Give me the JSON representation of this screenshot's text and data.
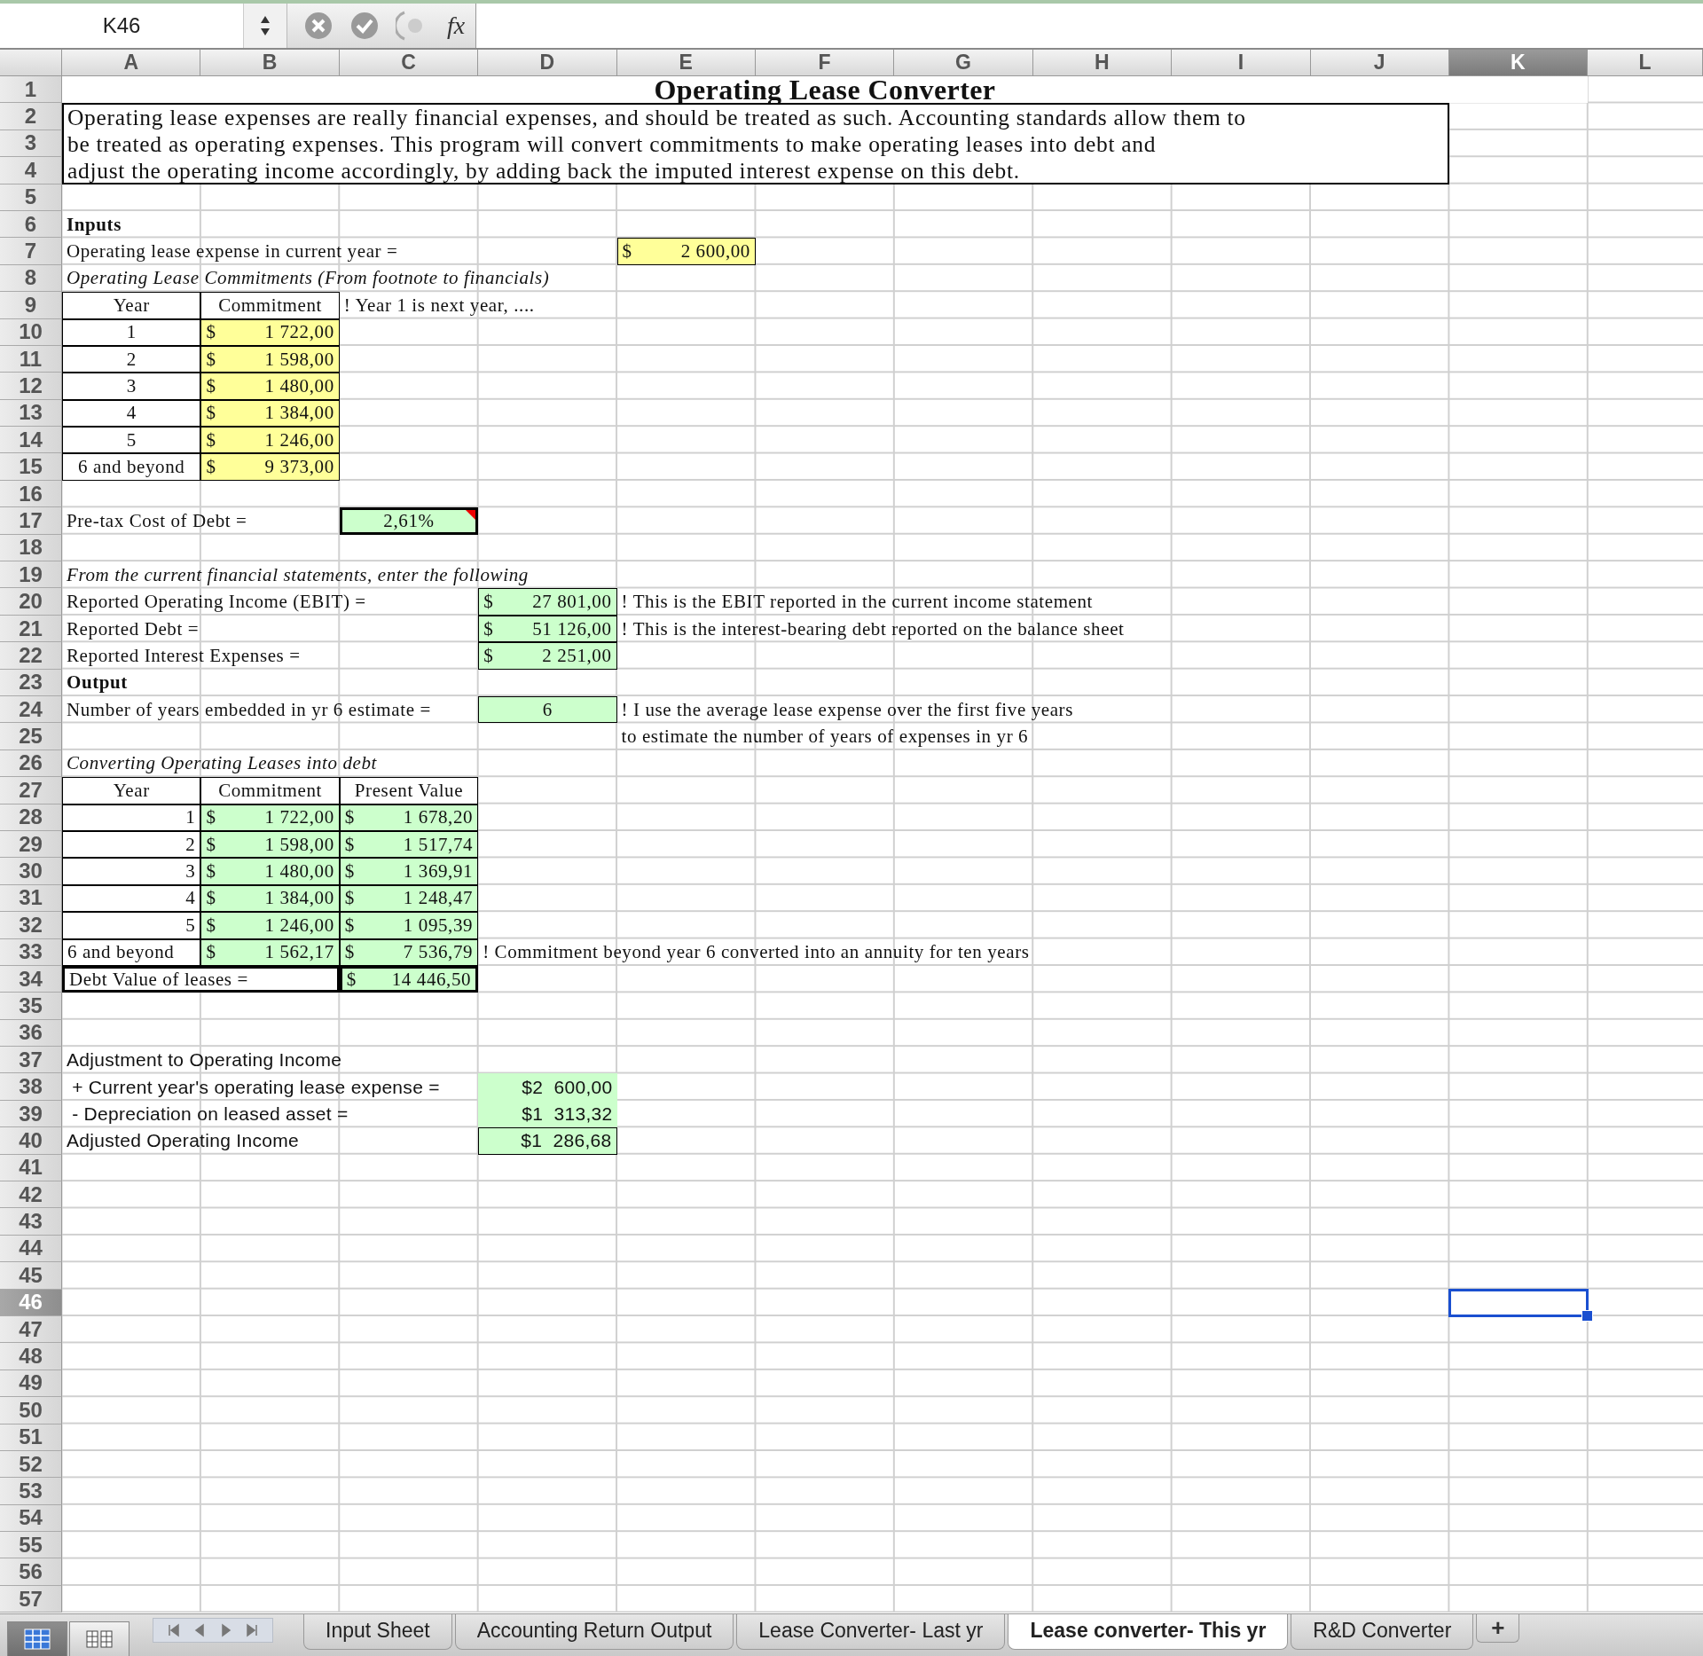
{
  "formula_bar": {
    "name_box": "K46",
    "function_label": "fx"
  },
  "columns": [
    {
      "label": "A",
      "selected": false
    },
    {
      "label": "B",
      "selected": false
    },
    {
      "label": "C",
      "selected": false
    },
    {
      "label": "D",
      "selected": false
    },
    {
      "label": "E",
      "selected": false
    },
    {
      "label": "F",
      "selected": false
    },
    {
      "label": "G",
      "selected": false
    },
    {
      "label": "H",
      "selected": false
    },
    {
      "label": "I",
      "selected": false
    },
    {
      "label": "J",
      "selected": false
    },
    {
      "label": "K",
      "selected": true
    },
    {
      "label": "L",
      "selected": false
    }
  ],
  "rows": [
    {
      "label": "1",
      "selected": false
    },
    {
      "label": "2",
      "selected": false
    },
    {
      "label": "3",
      "selected": false
    },
    {
      "label": "4",
      "selected": false
    },
    {
      "label": "5",
      "selected": false
    },
    {
      "label": "6",
      "selected": false
    },
    {
      "label": "7",
      "selected": false
    },
    {
      "label": "8",
      "selected": false
    },
    {
      "label": "9",
      "selected": false
    },
    {
      "label": "10",
      "selected": false
    },
    {
      "label": "11",
      "selected": false
    },
    {
      "label": "12",
      "selected": false
    },
    {
      "label": "13",
      "selected": false
    },
    {
      "label": "14",
      "selected": false
    },
    {
      "label": "15",
      "selected": false
    },
    {
      "label": "16",
      "selected": false
    },
    {
      "label": "17",
      "selected": false
    },
    {
      "label": "18",
      "selected": false
    },
    {
      "label": "19",
      "selected": false
    },
    {
      "label": "20",
      "selected": false
    },
    {
      "label": "21",
      "selected": false
    },
    {
      "label": "22",
      "selected": false
    },
    {
      "label": "23",
      "selected": false
    },
    {
      "label": "24",
      "selected": false
    },
    {
      "label": "25",
      "selected": false
    },
    {
      "label": "26",
      "selected": false
    },
    {
      "label": "27",
      "selected": false
    },
    {
      "label": "28",
      "selected": false
    },
    {
      "label": "29",
      "selected": false
    },
    {
      "label": "30",
      "selected": false
    },
    {
      "label": "31",
      "selected": false
    },
    {
      "label": "32",
      "selected": false
    },
    {
      "label": "33",
      "selected": false
    },
    {
      "label": "34",
      "selected": false
    },
    {
      "label": "35",
      "selected": false
    },
    {
      "label": "36",
      "selected": false
    },
    {
      "label": "37",
      "selected": false
    },
    {
      "label": "38",
      "selected": false
    },
    {
      "label": "39",
      "selected": false
    },
    {
      "label": "40",
      "selected": false
    },
    {
      "label": "41",
      "selected": false
    },
    {
      "label": "42",
      "selected": false
    },
    {
      "label": "43",
      "selected": false
    },
    {
      "label": "44",
      "selected": false
    },
    {
      "label": "45",
      "selected": false
    },
    {
      "label": "46",
      "selected": true
    },
    {
      "label": "47",
      "selected": false
    },
    {
      "label": "48",
      "selected": false
    },
    {
      "label": "49",
      "selected": false
    },
    {
      "label": "50",
      "selected": false
    },
    {
      "label": "51",
      "selected": false
    },
    {
      "label": "52",
      "selected": false
    },
    {
      "label": "53",
      "selected": false
    },
    {
      "label": "54",
      "selected": false
    },
    {
      "label": "55",
      "selected": false
    },
    {
      "label": "56",
      "selected": false
    },
    {
      "label": "57",
      "selected": false
    }
  ],
  "sheet": {
    "title": "Operating Lease Converter",
    "description": [
      "Operating lease expenses are really financial expenses, and should be treated as such. Accounting standards allow them to",
      "be treated as operating expenses. This program will convert commitments to make operating leases into debt and",
      "adjust the operating income accordingly, by adding back the imputed interest expense on this debt."
    ],
    "inputs_heading": "Inputs",
    "lease_expense": {
      "label": "Operating lease expense in current year =",
      "unit": "$",
      "amount": "2 600,00"
    },
    "commitments_heading": "Operating Lease Commitments (From footnote to financials)",
    "commitment_table": {
      "columns": [
        "Year",
        "Commitment"
      ],
      "note": "! Year 1 is next year, ....",
      "rows": [
        {
          "year": "1",
          "unit": "$",
          "amount": "1 722,00"
        },
        {
          "year": "2",
          "unit": "$",
          "amount": "1 598,00"
        },
        {
          "year": "3",
          "unit": "$",
          "amount": "1 480,00"
        },
        {
          "year": "4",
          "unit": "$",
          "amount": "1 384,00"
        },
        {
          "year": "5",
          "unit": "$",
          "amount": "1 246,00"
        },
        {
          "year": "6 and beyond",
          "unit": "$",
          "amount": "9 373,00"
        }
      ]
    },
    "cost_of_debt": {
      "label": "Pre-tax Cost of Debt =",
      "value": "2,61%",
      "comment": true
    },
    "statements_heading": "From the current financial statements, enter the following",
    "statement_items": [
      {
        "label": "Reported Operating Income (EBIT) =",
        "unit": "$",
        "amount": "27 801,00",
        "note": "! This is the EBIT reported in the current income statement"
      },
      {
        "label": "Reported Debt =",
        "unit": "$",
        "amount": "51 126,00",
        "note": "! This is the interest-bearing debt reported on the balance sheet"
      },
      {
        "label": "Reported Interest Expenses =",
        "unit": "$",
        "amount": "2 251,00"
      }
    ],
    "output_heading": "Output",
    "years_embedded": {
      "label": "Number of years embedded in yr 6 estimate =",
      "value": "6",
      "note_lines": [
        "! I use the average lease expense over the first five years",
        "to estimate the number of years of expenses in yr 6"
      ]
    },
    "conversion_heading": "Converting Operating Leases into debt",
    "conversion_table": {
      "columns": [
        "Year",
        "Commitment",
        "Present Value"
      ],
      "rows": [
        {
          "year": "1",
          "unit": "$",
          "commitment": "1 722,00",
          "pv_unit": "$",
          "present_value": "1 678,20"
        },
        {
          "year": "2",
          "unit": "$",
          "commitment": "1 598,00",
          "pv_unit": "$",
          "present_value": "1 517,74"
        },
        {
          "year": "3",
          "unit": "$",
          "commitment": "1 480,00",
          "pv_unit": "$",
          "present_value": "1 369,91"
        },
        {
          "year": "4",
          "unit": "$",
          "commitment": "1 384,00",
          "pv_unit": "$",
          "present_value": "1 248,47"
        },
        {
          "year": "5",
          "unit": "$",
          "commitment": "1 246,00",
          "pv_unit": "$",
          "present_value": "1 095,39"
        },
        {
          "year": "6 and beyond",
          "unit": "$",
          "commitment": "1 562,17",
          "pv_unit": "$",
          "present_value": "7 536,79",
          "note": "! Commitment beyond year 6 converted into an annuity for ten years"
        }
      ]
    },
    "debt_value": {
      "label": "Debt Value of leases =",
      "unit": "$",
      "amount": "14 446,50"
    },
    "adjustment_heading": "Adjustment to Operating Income",
    "adjustment_items": [
      {
        "label": " + Current year's operating lease expense =",
        "value": "$2  600,00"
      },
      {
        "label": " - Depreciation on leased asset =",
        "value": "$1  313,32"
      },
      {
        "label": "Adjusted Operating Income",
        "value": "$1  286,68"
      }
    ]
  },
  "view_buttons": [
    {
      "kind": "normal",
      "selected": true
    },
    {
      "kind": "page_layout",
      "selected": false
    }
  ],
  "sheet_tabs": [
    {
      "label": "Input Sheet",
      "selected": false
    },
    {
      "label": "Accounting Return Output",
      "selected": false
    },
    {
      "label": "Lease Converter- Last yr",
      "selected": false
    },
    {
      "label": "Lease converter- This yr",
      "selected": true
    },
    {
      "label": "R&D Converter",
      "selected": false
    }
  ],
  "new_sheet_button": "+"
}
